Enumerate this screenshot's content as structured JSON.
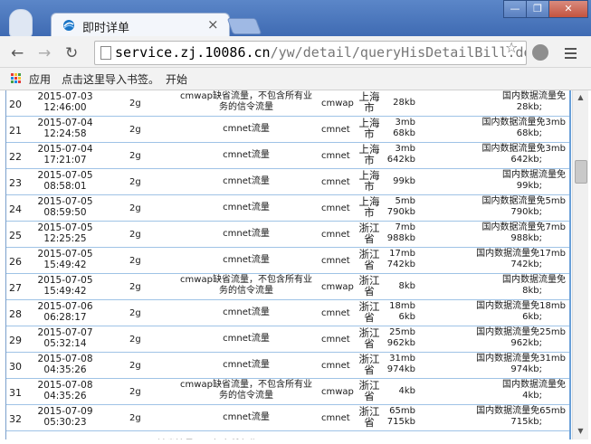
{
  "browser": {
    "tab_title": "即时详单",
    "tab_close": "×",
    "url_host": "service.zj.10086.cn",
    "url_path": "/yw/detail/queryHisDetailBill.do?bi",
    "window_buttons": [
      "—",
      "❐",
      "✕"
    ]
  },
  "bookmarks": {
    "apps_label": "应用",
    "import_label": "点击这里导入书签。",
    "start_label": "开始"
  },
  "rows": [
    {
      "idx": "20",
      "date": "2015-07-03",
      "time": "12:46:00",
      "net": "2g",
      "type1": "cmwap缺省流量，不包含所有业",
      "type2": "务的信令流量",
      "apn": "cmwap",
      "loc1": "上海",
      "loc2": "市",
      "amt1": "28kb",
      "amt2": "",
      "note1": "国内数据流量免",
      "note2": "28kb;"
    },
    {
      "idx": "21",
      "date": "2015-07-04",
      "time": "12:24:58",
      "net": "2g",
      "type1": "cmnet流量",
      "type2": "",
      "apn": "cmnet",
      "loc1": "上海",
      "loc2": "市",
      "amt1": "3mb",
      "amt2": "68kb",
      "note1": "国内数据流量免3mb",
      "note2": "68kb;"
    },
    {
      "idx": "22",
      "date": "2015-07-04",
      "time": "17:21:07",
      "net": "2g",
      "type1": "cmnet流量",
      "type2": "",
      "apn": "cmnet",
      "loc1": "上海",
      "loc2": "市",
      "amt1": "3mb",
      "amt2": "642kb",
      "note1": "国内数据流量免3mb",
      "note2": "642kb;"
    },
    {
      "idx": "23",
      "date": "2015-07-05",
      "time": "08:58:01",
      "net": "2g",
      "type1": "cmnet流量",
      "type2": "",
      "apn": "cmnet",
      "loc1": "上海",
      "loc2": "市",
      "amt1": "99kb",
      "amt2": "",
      "note1": "国内数据流量免",
      "note2": "99kb;"
    },
    {
      "idx": "24",
      "date": "2015-07-05",
      "time": "08:59:50",
      "net": "2g",
      "type1": "cmnet流量",
      "type2": "",
      "apn": "cmnet",
      "loc1": "上海",
      "loc2": "市",
      "amt1": "5mb",
      "amt2": "790kb",
      "note1": "国内数据流量免5mb",
      "note2": "790kb;"
    },
    {
      "idx": "25",
      "date": "2015-07-05",
      "time": "12:25:25",
      "net": "2g",
      "type1": "cmnet流量",
      "type2": "",
      "apn": "cmnet",
      "loc1": "浙江",
      "loc2": "省",
      "amt1": "7mb",
      "amt2": "988kb",
      "note1": "国内数据流量免7mb",
      "note2": "988kb;"
    },
    {
      "idx": "26",
      "date": "2015-07-05",
      "time": "15:49:42",
      "net": "2g",
      "type1": "cmnet流量",
      "type2": "",
      "apn": "cmnet",
      "loc1": "浙江",
      "loc2": "省",
      "amt1": "17mb",
      "amt2": "742kb",
      "note1": "国内数据流量免17mb",
      "note2": "742kb;"
    },
    {
      "idx": "27",
      "date": "2015-07-05",
      "time": "15:49:42",
      "net": "2g",
      "type1": "cmwap缺省流量，不包含所有业",
      "type2": "务的信令流量",
      "apn": "cmwap",
      "loc1": "浙江",
      "loc2": "省",
      "amt1": "8kb",
      "amt2": "",
      "note1": "国内数据流量免",
      "note2": "8kb;"
    },
    {
      "idx": "28",
      "date": "2015-07-06",
      "time": "06:28:17",
      "net": "2g",
      "type1": "cmnet流量",
      "type2": "",
      "apn": "cmnet",
      "loc1": "浙江",
      "loc2": "省",
      "amt1": "18mb",
      "amt2": "6kb",
      "note1": "国内数据流量免18mb",
      "note2": "6kb;"
    },
    {
      "idx": "29",
      "date": "2015-07-07",
      "time": "05:32:14",
      "net": "2g",
      "type1": "cmnet流量",
      "type2": "",
      "apn": "cmnet",
      "loc1": "浙江",
      "loc2": "省",
      "amt1": "25mb",
      "amt2": "962kb",
      "note1": "国内数据流量免25mb",
      "note2": "962kb;"
    },
    {
      "idx": "30",
      "date": "2015-07-08",
      "time": "04:35:26",
      "net": "2g",
      "type1": "cmnet流量",
      "type2": "",
      "apn": "cmnet",
      "loc1": "浙江",
      "loc2": "省",
      "amt1": "31mb",
      "amt2": "974kb",
      "note1": "国内数据流量免31mb",
      "note2": "974kb;"
    },
    {
      "idx": "31",
      "date": "2015-07-08",
      "time": "04:35:26",
      "net": "2g",
      "type1": "cmwap缺省流量，不包含所有业",
      "type2": "务的信令流量",
      "apn": "cmwap",
      "loc1": "浙江",
      "loc2": "省",
      "amt1": "4kb",
      "amt2": "",
      "note1": "国内数据流量免",
      "note2": "4kb;"
    },
    {
      "idx": "32",
      "date": "2015-07-09",
      "time": "05:30:23",
      "net": "2g",
      "type1": "cmnet流量",
      "type2": "",
      "apn": "cmnet",
      "loc1": "浙江",
      "loc2": "省",
      "amt1": "65mb",
      "amt2": "715kb",
      "note1": "国内数据流量免65mb",
      "note2": "715kb;"
    }
  ],
  "colors": {
    "titlebar": "#4a78be",
    "row_border": "#9fc3e6",
    "accent": "#6aa0d8"
  }
}
